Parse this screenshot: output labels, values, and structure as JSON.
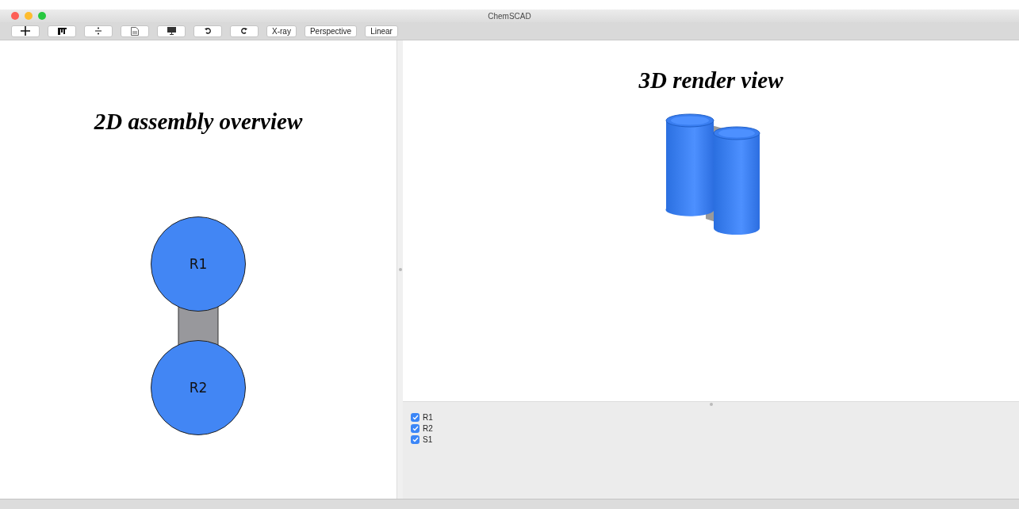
{
  "window": {
    "title": "ChemSCAD"
  },
  "toolbar": {
    "text_buttons": [
      "X-ray",
      "Perspective",
      "Linear"
    ]
  },
  "overview": {
    "title": "2D assembly overview",
    "nodes": [
      {
        "label": "R1"
      },
      {
        "label": "R2"
      }
    ]
  },
  "render": {
    "title": "3D render view"
  },
  "components": [
    {
      "label": "R1",
      "checked": true
    },
    {
      "label": "R2",
      "checked": true
    },
    {
      "label": "S1",
      "checked": true
    }
  ]
}
